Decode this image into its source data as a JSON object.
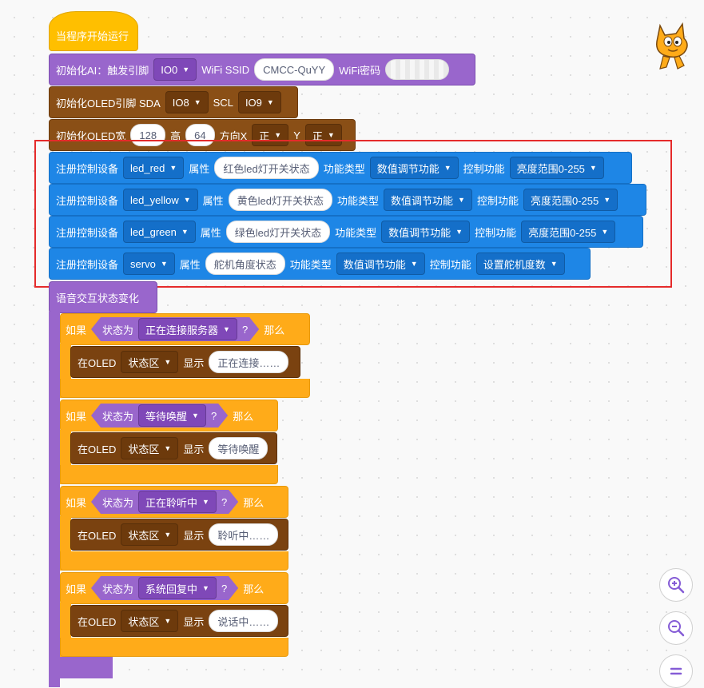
{
  "hat": {
    "label": "当程序开始运行"
  },
  "init_ai": {
    "label": "初始化AI：触发引脚",
    "pin": "IO0",
    "ssid_label": "WiFi SSID",
    "ssid": "CMCC-QuYY",
    "pwd_label": "WiFi密码"
  },
  "init_oled_pins": {
    "label": "初始化OLED引脚 SDA",
    "sda": "IO8",
    "scl_label": "SCL",
    "scl": "IO9"
  },
  "init_oled_size": {
    "label": "初始化OLED宽",
    "width": "128",
    "height_label": "高",
    "height": "64",
    "dirx_label": "方向X",
    "dirx": "正",
    "y_label": "Y",
    "diry": "正"
  },
  "register": {
    "label": "注册控制设备",
    "attr_label": "属性",
    "type_label": "功能类型",
    "ctrl_label": "控制功能",
    "rows": [
      {
        "device": "led_red",
        "attr": "红色led灯开关状态",
        "type": "数值调节功能",
        "ctrl": "亮度范围0-255"
      },
      {
        "device": "led_yellow",
        "attr": "黄色led灯开关状态",
        "type": "数值调节功能",
        "ctrl": "亮度范围0-255"
      },
      {
        "device": "led_green",
        "attr": "绿色led灯开关状态",
        "type": "数值调节功能",
        "ctrl": "亮度范围0-255"
      },
      {
        "device": "servo",
        "attr": "舵机角度状态",
        "type": "数值调节功能",
        "ctrl": "设置舵机度数"
      }
    ]
  },
  "voice_event": {
    "label": "语音交互状态变化"
  },
  "if_blocks": {
    "if_label": "如果",
    "state_label": "状态为",
    "q": "?",
    "then_label": "那么",
    "oled_label": "在OLED",
    "area": "状态区",
    "show_label": "显示",
    "items": [
      {
        "state": "正在连接服务器",
        "text": "正在连接……"
      },
      {
        "state": "等待唤醒",
        "text": "等待唤醒"
      },
      {
        "state": "正在聆听中",
        "text": "聆听中……"
      },
      {
        "state": "系统回复中",
        "text": "说话中……"
      }
    ]
  },
  "zoom": {
    "in_icon": "zoom-in-icon",
    "out_icon": "zoom-out-icon",
    "reset_icon": "zoom-reset-icon"
  },
  "colors": {
    "event": "#ffbf00",
    "ai": "#9966cc",
    "oled": "#8a4f16",
    "iot": "#1e86e6",
    "control": "#ffab19",
    "highlight": "#e52b2b"
  }
}
